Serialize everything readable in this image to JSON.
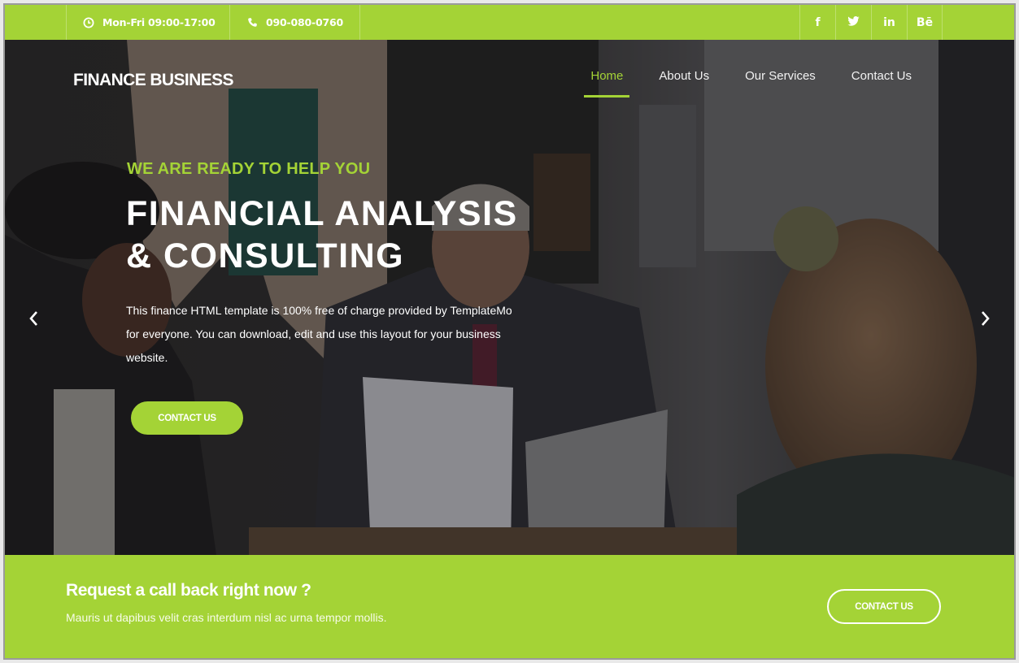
{
  "topbar": {
    "hours": {
      "icon": "clock-icon",
      "text": "Mon-Fri 09:00-17:00"
    },
    "phone": {
      "icon": "phone-icon",
      "text": "090-080-0760"
    },
    "social": [
      {
        "name": "facebook",
        "icon": "facebook-icon",
        "glyph": "f"
      },
      {
        "name": "twitter",
        "icon": "twitter-icon",
        "glyph": ""
      },
      {
        "name": "linkedin",
        "icon": "linkedin-icon",
        "glyph": "in"
      },
      {
        "name": "behance",
        "icon": "behance-icon",
        "glyph": "Bē"
      }
    ]
  },
  "header": {
    "brand": "FINANCE BUSINESS",
    "nav": [
      {
        "label": "Home",
        "active": true
      },
      {
        "label": "About Us",
        "active": false
      },
      {
        "label": "Our Services",
        "active": false
      },
      {
        "label": "Contact Us",
        "active": false
      }
    ]
  },
  "hero": {
    "kicker": "WE ARE READY TO HELP YOU",
    "headline_line1": "FINANCIAL ANALYSIS",
    "headline_line2": "& CONSULTING",
    "description_line1": "This finance HTML template is 100% free of charge provided by TemplateMo",
    "description_line2": "for everyone. You can download, edit and use this layout for your business",
    "description_line3": "website.",
    "button_label": "CONTACT US",
    "prev_icon": "chevron-left-icon",
    "next_icon": "chevron-right-icon"
  },
  "cta": {
    "title": "Request a call back right now ?",
    "subtitle": "Mauris ut dapibus velit cras interdum nisl ac urna tempor mollis.",
    "button_label": "CONTACT US"
  },
  "colors": {
    "accent": "#a4d336",
    "text_light": "#ffffff"
  }
}
